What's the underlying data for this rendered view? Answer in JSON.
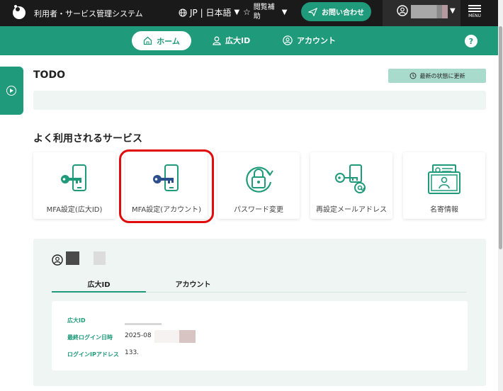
{
  "header": {
    "app_title": "利用者・サービス管理システム",
    "language": "JP | 日本語",
    "assist_label": "閲覧補助",
    "contact_label": "お問い合わせ",
    "menu_label": "MENU"
  },
  "nav": {
    "home": "ホーム",
    "kodai_id": "広大ID",
    "account": "アカウント",
    "help": "?"
  },
  "todo": {
    "title": "TODO",
    "refresh_label": "最新の状態に更新"
  },
  "services": {
    "title": "よく利用されるサービス",
    "items": [
      {
        "label": "MFA設定(広大ID)",
        "icon": "phone-key-icon"
      },
      {
        "label": "MFA設定(アカウント)",
        "icon": "phone-key-icon"
      },
      {
        "label": "パスワード変更",
        "icon": "lock-refresh-icon"
      },
      {
        "label": "再設定メールアドレス",
        "icon": "key-mail-icon"
      },
      {
        "label": "名寄情報",
        "icon": "profile-box-icon"
      }
    ]
  },
  "account_panel": {
    "tabs": [
      "広大ID",
      "アカウント"
    ],
    "fields": [
      {
        "label": "広大ID",
        "value": ""
      },
      {
        "label": "最終ログイン日時",
        "value": "2025-08"
      },
      {
        "label": "ログインIPアドレス",
        "value": "133."
      }
    ]
  },
  "colors": {
    "brand": "#1f9a7a",
    "highlight": "#e20c0c",
    "panel": "#eef5f2"
  }
}
